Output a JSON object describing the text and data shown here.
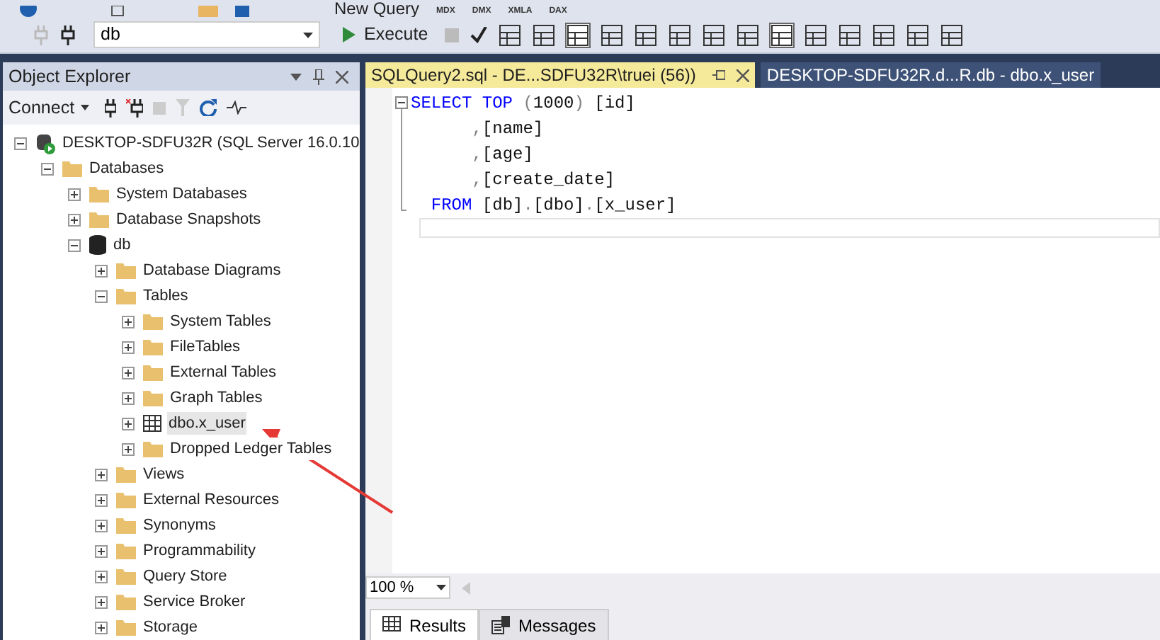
{
  "toolbar_top": {
    "new_query": "New Query",
    "script_buttons": [
      "MDX",
      "DMX",
      "XMLA",
      "DAX"
    ]
  },
  "toolbar": {
    "database": "db",
    "execute": "Execute"
  },
  "object_explorer": {
    "title": "Object Explorer",
    "connect": "Connect",
    "tree": [
      {
        "label": "DESKTOP-SDFU32R (SQL Server 16.0.10",
        "kind": "server",
        "expanded": true,
        "selected": false,
        "children": [
          {
            "label": "Databases",
            "kind": "folder",
            "expanded": true,
            "selected": false,
            "children": [
              {
                "label": "System Databases",
                "kind": "folder",
                "expanded": false,
                "selected": false
              },
              {
                "label": "Database Snapshots",
                "kind": "folder",
                "expanded": false,
                "selected": false
              },
              {
                "label": "db",
                "kind": "database",
                "expanded": true,
                "selected": false,
                "children": [
                  {
                    "label": "Database Diagrams",
                    "kind": "folder",
                    "expanded": false,
                    "selected": false
                  },
                  {
                    "label": "Tables",
                    "kind": "folder",
                    "expanded": true,
                    "selected": false,
                    "children": [
                      {
                        "label": "System Tables",
                        "kind": "folder",
                        "expanded": false,
                        "selected": false
                      },
                      {
                        "label": "FileTables",
                        "kind": "folder",
                        "expanded": false,
                        "selected": false
                      },
                      {
                        "label": "External Tables",
                        "kind": "folder",
                        "expanded": false,
                        "selected": false
                      },
                      {
                        "label": "Graph Tables",
                        "kind": "folder",
                        "expanded": false,
                        "selected": false
                      },
                      {
                        "label": "dbo.x_user",
                        "kind": "table",
                        "expanded": false,
                        "selected": true
                      },
                      {
                        "label": "Dropped Ledger Tables",
                        "kind": "folder",
                        "expanded": false,
                        "selected": false
                      }
                    ]
                  },
                  {
                    "label": "Views",
                    "kind": "folder",
                    "expanded": false,
                    "selected": false
                  },
                  {
                    "label": "External Resources",
                    "kind": "folder",
                    "expanded": false,
                    "selected": false
                  },
                  {
                    "label": "Synonyms",
                    "kind": "folder",
                    "expanded": false,
                    "selected": false
                  },
                  {
                    "label": "Programmability",
                    "kind": "folder",
                    "expanded": false,
                    "selected": false
                  },
                  {
                    "label": "Query Store",
                    "kind": "folder",
                    "expanded": false,
                    "selected": false
                  },
                  {
                    "label": "Service Broker",
                    "kind": "folder",
                    "expanded": false,
                    "selected": false
                  },
                  {
                    "label": "Storage",
                    "kind": "folder",
                    "expanded": false,
                    "selected": false
                  }
                ]
              }
            ]
          }
        ]
      }
    ]
  },
  "tabs": [
    {
      "label": "SQLQuery2.sql - DE...SDFU32R\\truei (56))",
      "selected": true
    },
    {
      "label": "DESKTOP-SDFU32R.d...R.db - dbo.x_user",
      "selected": false
    }
  ],
  "editor": {
    "lines": [
      [
        {
          "text": "SELECT TOP",
          "kind": "keyword"
        },
        {
          "text": " (",
          "kind": "operator"
        },
        {
          "text": "1000",
          "kind": "plain"
        },
        {
          "text": ")",
          "kind": "operator"
        },
        {
          "text": " [id]",
          "kind": "plain"
        }
      ],
      [
        {
          "text": "      ,",
          "kind": "operator"
        },
        {
          "text": "[name]",
          "kind": "plain"
        }
      ],
      [
        {
          "text": "      ,",
          "kind": "operator"
        },
        {
          "text": "[age]",
          "kind": "plain"
        }
      ],
      [
        {
          "text": "      ,",
          "kind": "operator"
        },
        {
          "text": "[create_date]",
          "kind": "plain"
        }
      ],
      [
        {
          "text": "  FROM",
          "kind": "keyword"
        },
        {
          "text": " [db]",
          "kind": "plain"
        },
        {
          "text": ".",
          "kind": "operator"
        },
        {
          "text": "[dbo]",
          "kind": "plain"
        },
        {
          "text": ".",
          "kind": "operator"
        },
        {
          "text": "[x_user]",
          "kind": "plain"
        }
      ]
    ]
  },
  "zoom": "100 %",
  "result_tabs": [
    {
      "label": "Results",
      "kind": "grid",
      "selected": true
    },
    {
      "label": "Messages",
      "kind": "messages",
      "selected": false
    }
  ]
}
